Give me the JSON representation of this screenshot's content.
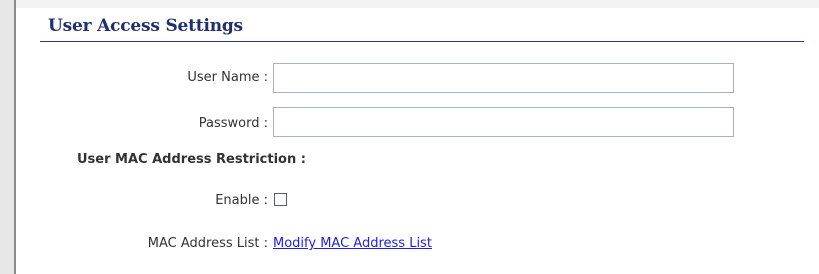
{
  "section": {
    "title": "User Access Settings"
  },
  "form": {
    "username": {
      "label": "User Name :",
      "value": "",
      "placeholder": ""
    },
    "password": {
      "label": "Password :",
      "value": "",
      "placeholder": ""
    },
    "mac_restriction": {
      "heading": "User MAC Address Restriction :",
      "enable_label": "Enable :",
      "enabled": false,
      "list_label": "MAC Address List :",
      "list_link": "Modify MAC Address List"
    }
  },
  "colors": {
    "title": "#1f2f73",
    "link": "#1e1ee6",
    "text": "#333333"
  }
}
